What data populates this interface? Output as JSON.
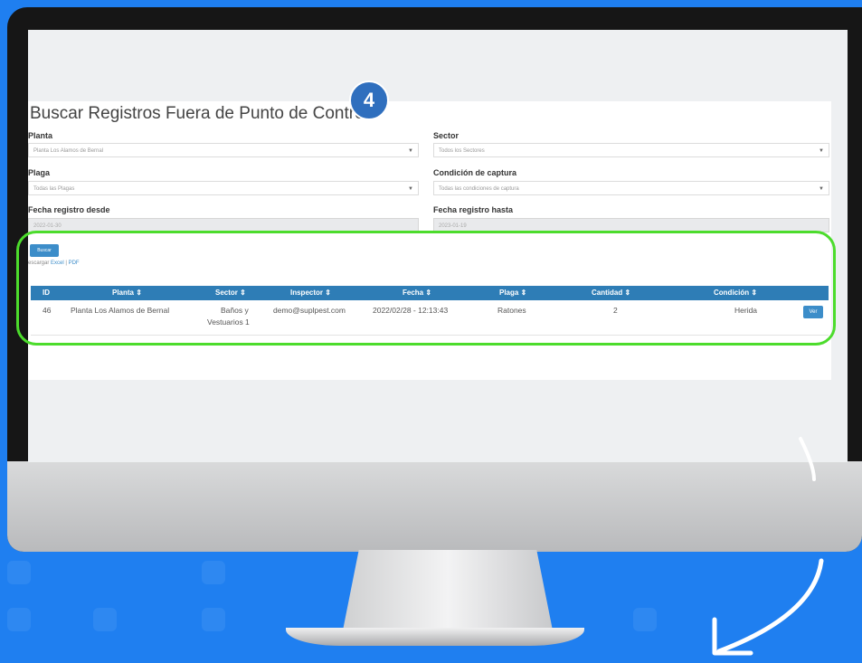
{
  "title": "Buscar Registros Fuera de Punto de Control",
  "step_badge": "4",
  "filters": {
    "planta": {
      "label": "Planta",
      "value": "Planta Los Alamos de Bernal"
    },
    "sector": {
      "label": "Sector",
      "value": "Todos los Sectores"
    },
    "plaga": {
      "label": "Plaga",
      "value": "Todas las Plagas"
    },
    "condicion": {
      "label": "Condición de captura",
      "value": "Todas las condiciones de captura"
    },
    "fecha_desde": {
      "label": "Fecha registro desde",
      "value": "2022-01-30"
    },
    "fecha_hasta": {
      "label": "Fecha registro hasta",
      "value": "2023-01-19"
    }
  },
  "search_button": "Buscar",
  "download": {
    "prefix": "escargar",
    "excel": "Excel",
    "separator": "|",
    "pdf": "PDF"
  },
  "table": {
    "columns": [
      "ID",
      "Planta ⇕",
      "Sector ⇕",
      "Inspector ⇕",
      "Fecha ⇕",
      "Plaga ⇕",
      "Cantidad ⇕",
      "Condición ⇕"
    ],
    "rows": [
      {
        "id": "46",
        "planta": "Planta Los Alamos de Bernal",
        "sector_line1": "Baños y",
        "sector_line2": "Vestuarios 1",
        "inspector": "demo@suplpest.com",
        "fecha": "2022/02/28 - 12:13:43",
        "plaga": "Ratones",
        "cantidad": "2",
        "condicion": "Herida",
        "action": "Ver"
      }
    ]
  },
  "colors": {
    "accent": "#3c8dc9",
    "header": "#2e7db6",
    "highlight": "#4cdc2c",
    "background": "#1f7ff0",
    "badge": "#2f6fbe"
  }
}
